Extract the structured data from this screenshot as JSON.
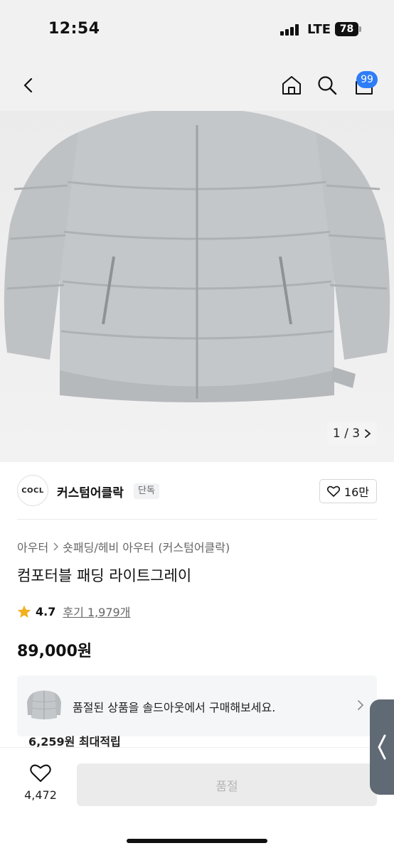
{
  "status_bar": {
    "time": "12:54",
    "network": "LTE",
    "battery": "78"
  },
  "nav": {
    "cart_badge": "99"
  },
  "gallery": {
    "pager": "1 / 3"
  },
  "seller": {
    "logo_text": "COCL",
    "name": "커스텀어클락",
    "badge": "단독",
    "likes": "16만"
  },
  "breadcrumb": {
    "category": "아우터",
    "subcategory": "숏패딩/헤비 아우터",
    "brand": "(커스텀어클락)"
  },
  "product": {
    "title": "컴포터블 패딩 라이트그레이",
    "rating": "4.7",
    "reviews": "후기 1,979개",
    "price": "89,000원"
  },
  "soldout_banner": {
    "text": "품절된 상품을 솔드아웃에서 구매해보세요."
  },
  "reward": "6,259원 최대적립",
  "bottom_bar": {
    "wish_count": "4,472",
    "buy_label": "품절"
  },
  "colors": {
    "badge_blue": "#2f7df6",
    "star": "#f2b01e",
    "jacket": "#c4c7ca"
  }
}
